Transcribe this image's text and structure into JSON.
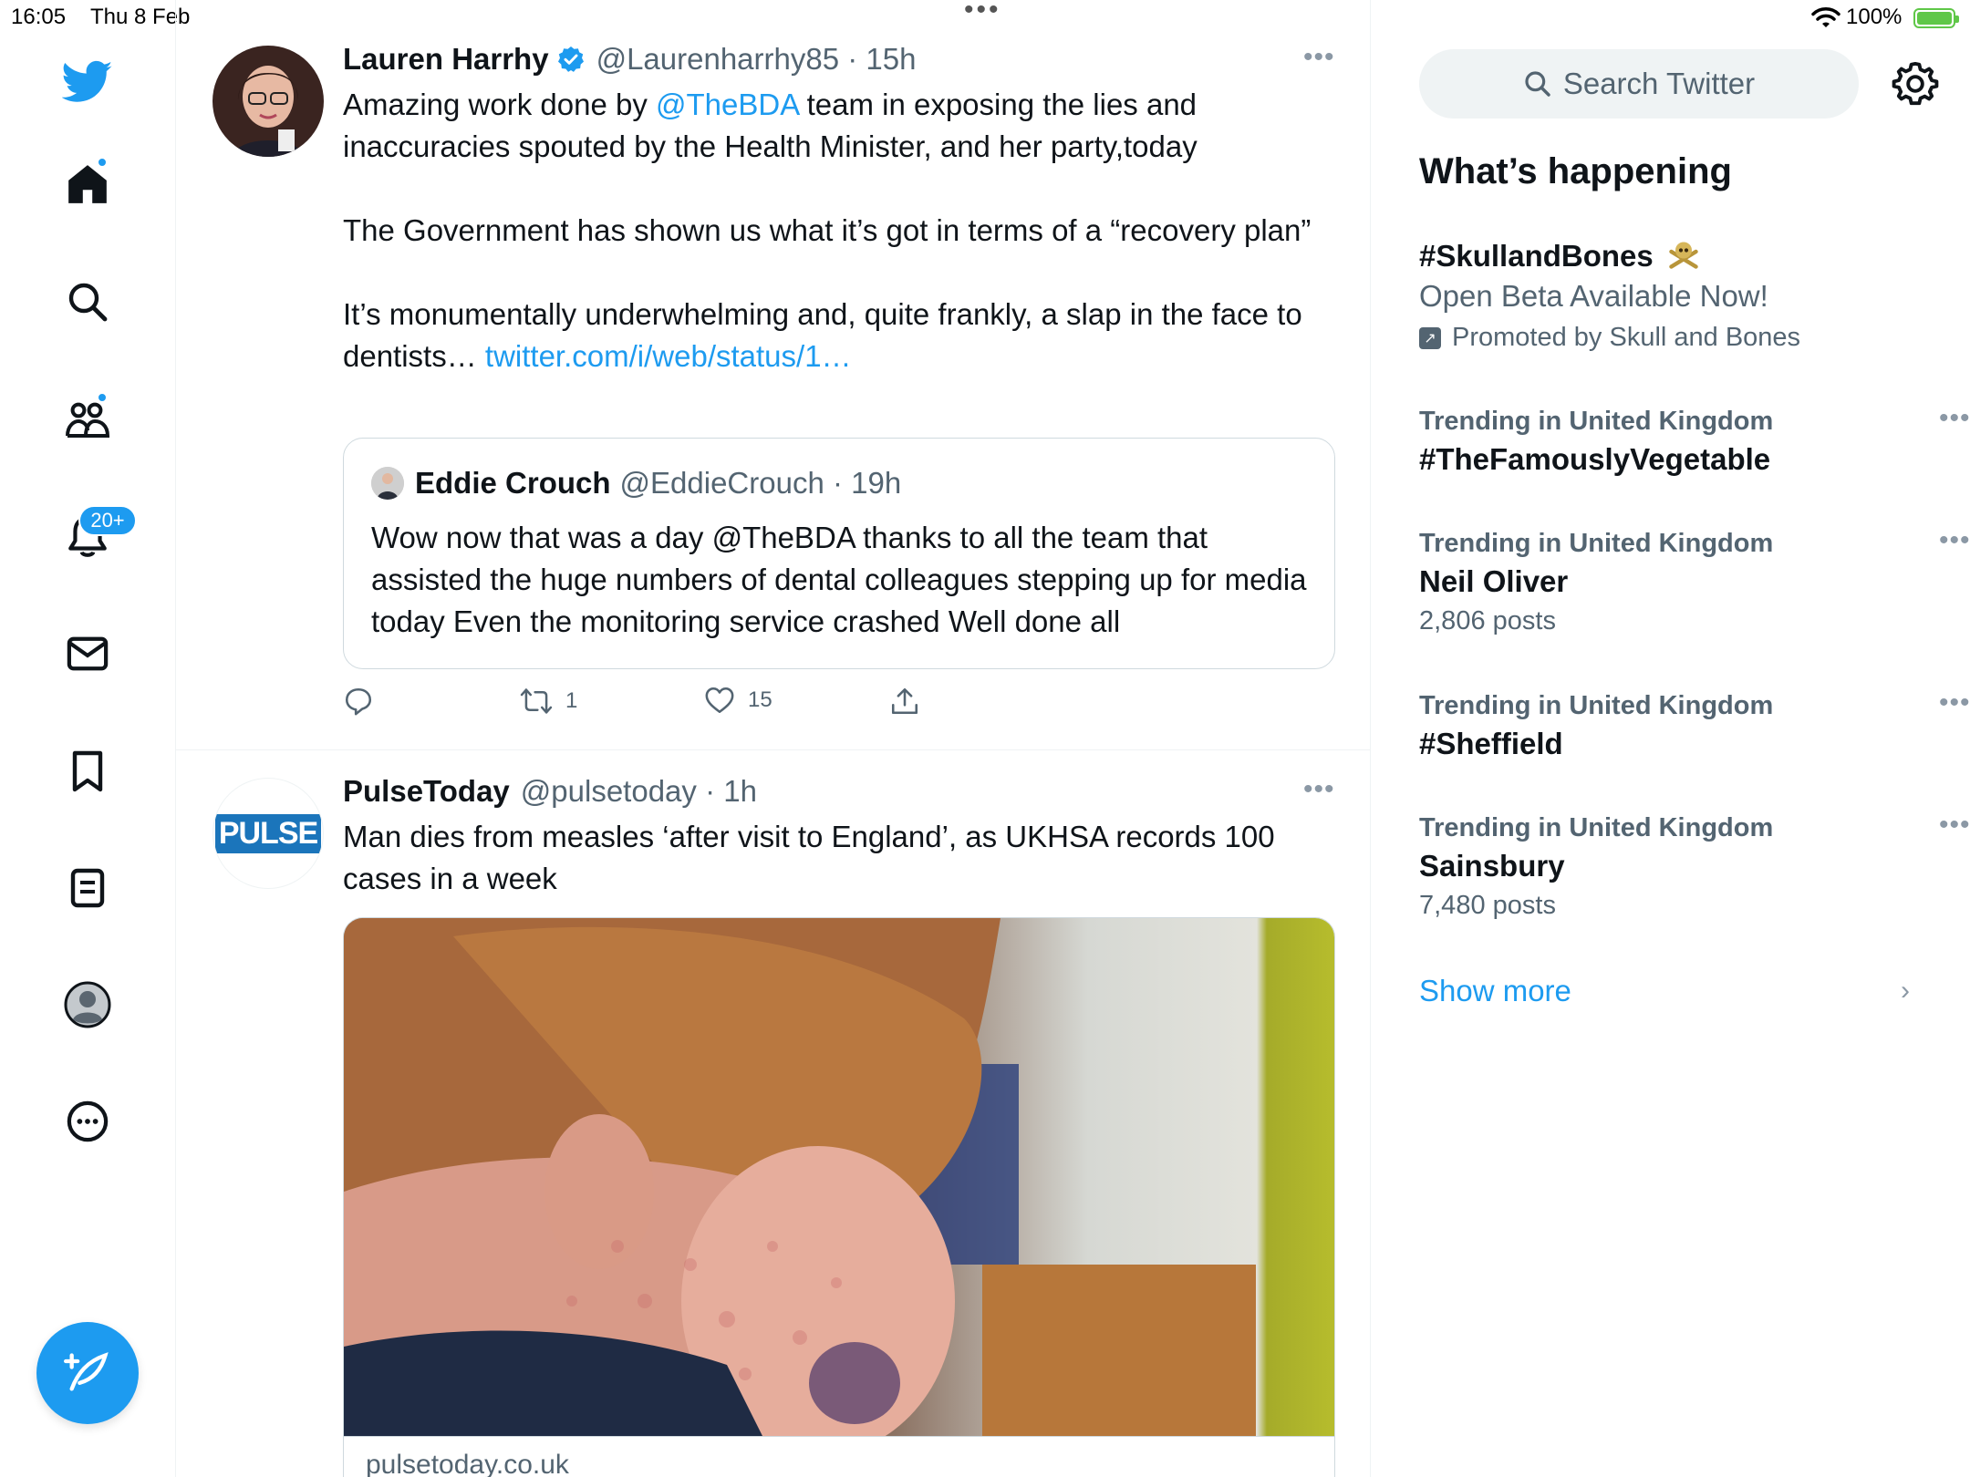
{
  "status_bar": {
    "time": "16:05",
    "date": "Thu 8 Feb",
    "battery": "100%"
  },
  "colors": {
    "accent": "#1d9bf0",
    "text": "#0f1419",
    "secondary": "#536471",
    "border": "#cfd9de"
  },
  "nav": {
    "items": [
      {
        "icon": "twitter-logo-icon"
      },
      {
        "icon": "home-icon"
      },
      {
        "icon": "search-icon"
      },
      {
        "icon": "communities-icon"
      },
      {
        "icon": "bell-icon"
      },
      {
        "icon": "mail-icon"
      },
      {
        "icon": "bookmark-icon"
      },
      {
        "icon": "lists-icon"
      },
      {
        "icon": "profile-icon"
      },
      {
        "icon": "more-circle-icon"
      }
    ],
    "notifications_badge": "20+"
  },
  "tweets": [
    {
      "name": "Lauren Harrhy",
      "handle": "@Laurenharrhy85 · 15h",
      "text_lines": [
        "Amazing work done by ",
        "@TheBDA",
        " team in exposing the lies and inaccuracies spouted by the Health Minister, and her party,today",
        "The Government has shown us what it’s got in terms of a “recovery plan”",
        "It’s monumentally underwhelming and, quite frankly, a slap in the face to dentists… ",
        "twitter.com/i/web/status/1…"
      ],
      "quote": {
        "name": "Eddie Crouch",
        "handle": "@EddieCrouch · 19h",
        "text": "Wow now that was a day @TheBDA thanks to all the team that assisted the huge numbers of dental colleagues stepping up for media today Even the monitoring service crashed Well done all"
      },
      "retweets": "1",
      "likes": "15"
    },
    {
      "name": "PulseToday",
      "handle": "@pulsetoday · 1h",
      "avatar_text": "PULSE",
      "text": "Man dies from measles ‘after visit to England’, as UKHSA records 100 cases in a week",
      "card_domain": "pulsetoday.co.uk"
    }
  ],
  "sidebar": {
    "search_placeholder": "Search Twitter",
    "title": "What’s happening",
    "promoted": {
      "name": "#SkullandBones",
      "desc": "Open Beta Available Now!",
      "by": "Promoted by Skull and Bones"
    },
    "trends": [
      {
        "context": "Trending in United Kingdom",
        "name": "#TheFamouslyVegetable",
        "posts": ""
      },
      {
        "context": "Trending in United Kingdom",
        "name": "Neil Oliver",
        "posts": "2,806 posts"
      },
      {
        "context": "Trending in United Kingdom",
        "name": "#Sheffield",
        "posts": ""
      },
      {
        "context": "Trending in United Kingdom",
        "name": "Sainsbury",
        "posts": "7,480 posts"
      }
    ],
    "show_more": "Show more"
  }
}
